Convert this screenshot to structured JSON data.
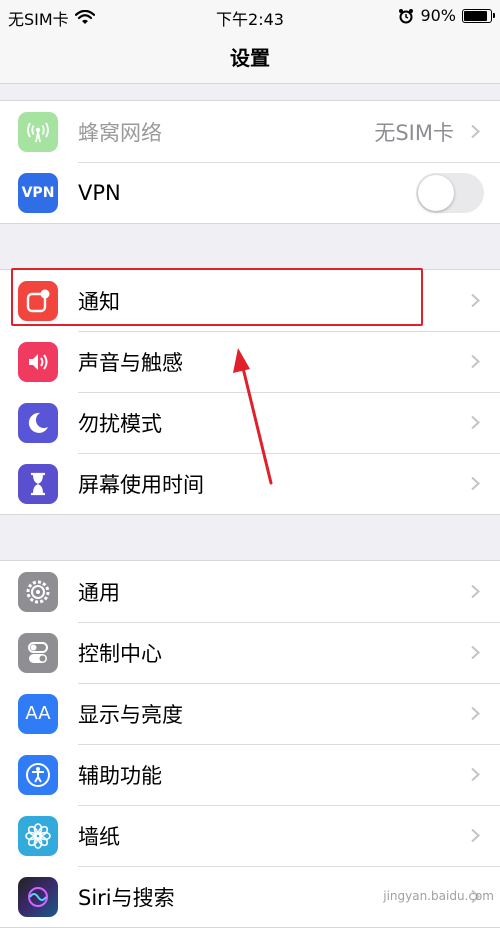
{
  "status": {
    "carrier": "无SIM卡",
    "time": "下午2:43",
    "battery": "90%",
    "battery_level": 0.9
  },
  "nav": {
    "title": "设置"
  },
  "group1": {
    "cellular": {
      "label": "蜂窝网络",
      "value": "无SIM卡",
      "icon": "antenna-icon",
      "color": "#a6e3a1"
    },
    "vpn": {
      "label": "VPN",
      "icon_text": "VPN",
      "color": "#2f6ee6",
      "toggle": "off"
    }
  },
  "group2": [
    {
      "label": "通知",
      "icon": "notifications-icon",
      "color": "#f2453d"
    },
    {
      "label": "声音与触感",
      "icon": "speaker-icon",
      "color": "#f03a5f"
    },
    {
      "label": "勿扰模式",
      "icon": "moon-icon",
      "color": "#5856d6"
    },
    {
      "label": "屏幕使用时间",
      "icon": "hourglass-icon",
      "color": "#5a4fcf"
    }
  ],
  "group3": [
    {
      "label": "通用",
      "icon": "gear-icon",
      "color": "#8e8e93"
    },
    {
      "label": "控制中心",
      "icon": "toggles-icon",
      "color": "#8e8e93"
    },
    {
      "label": "显示与亮度",
      "icon_text": "AA",
      "icon": "display-icon",
      "color": "#2f7cf6"
    },
    {
      "label": "辅助功能",
      "icon": "accessibility-icon",
      "color": "#2f7cf6"
    },
    {
      "label": "墙纸",
      "icon": "flower-icon",
      "color": "#32aadc"
    },
    {
      "label": "Siri与搜索",
      "icon": "siri-icon",
      "color": "#222222"
    }
  ],
  "watermark": "jingyan.baidu.com"
}
